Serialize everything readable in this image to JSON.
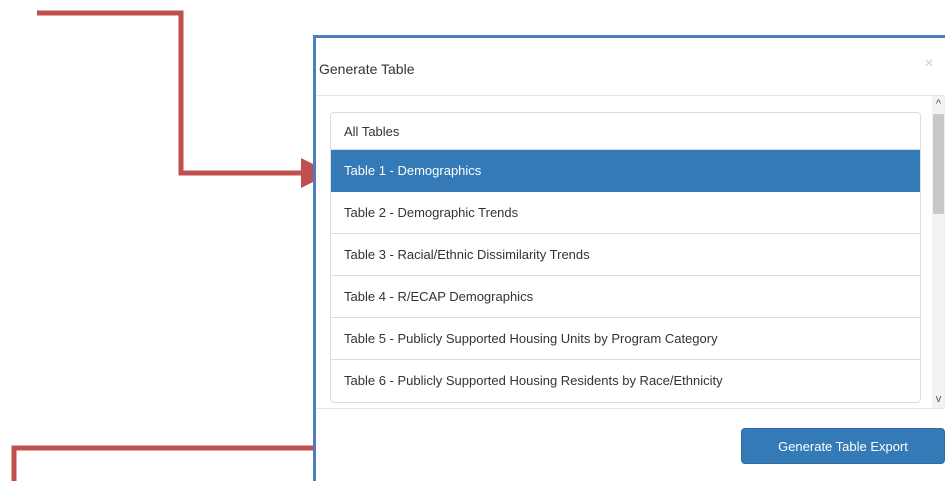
{
  "dialog": {
    "title": "Generate Table",
    "close_glyph": "×"
  },
  "tables": [
    {
      "label": "All Tables",
      "selected": false
    },
    {
      "label": "Table 1 - Demographics",
      "selected": true
    },
    {
      "label": "Table 2 - Demographic Trends",
      "selected": false
    },
    {
      "label": "Table 3 - Racial/Ethnic Dissimilarity Trends",
      "selected": false
    },
    {
      "label": "Table 4 - R/ECAP Demographics",
      "selected": false
    },
    {
      "label": "Table 5 - Publicly Supported Housing Units by Program Category",
      "selected": false
    },
    {
      "label": "Table 6 - Publicly Supported Housing Residents by Race/Ethnicity",
      "selected": false
    }
  ],
  "footer": {
    "export_label": "Generate Table Export"
  },
  "scroll": {
    "up_glyph": "^",
    "down_glyph": "v"
  },
  "colors": {
    "accent": "#337ab7",
    "arrow": "#c0504d",
    "modal_border": "#4b7fbd"
  }
}
